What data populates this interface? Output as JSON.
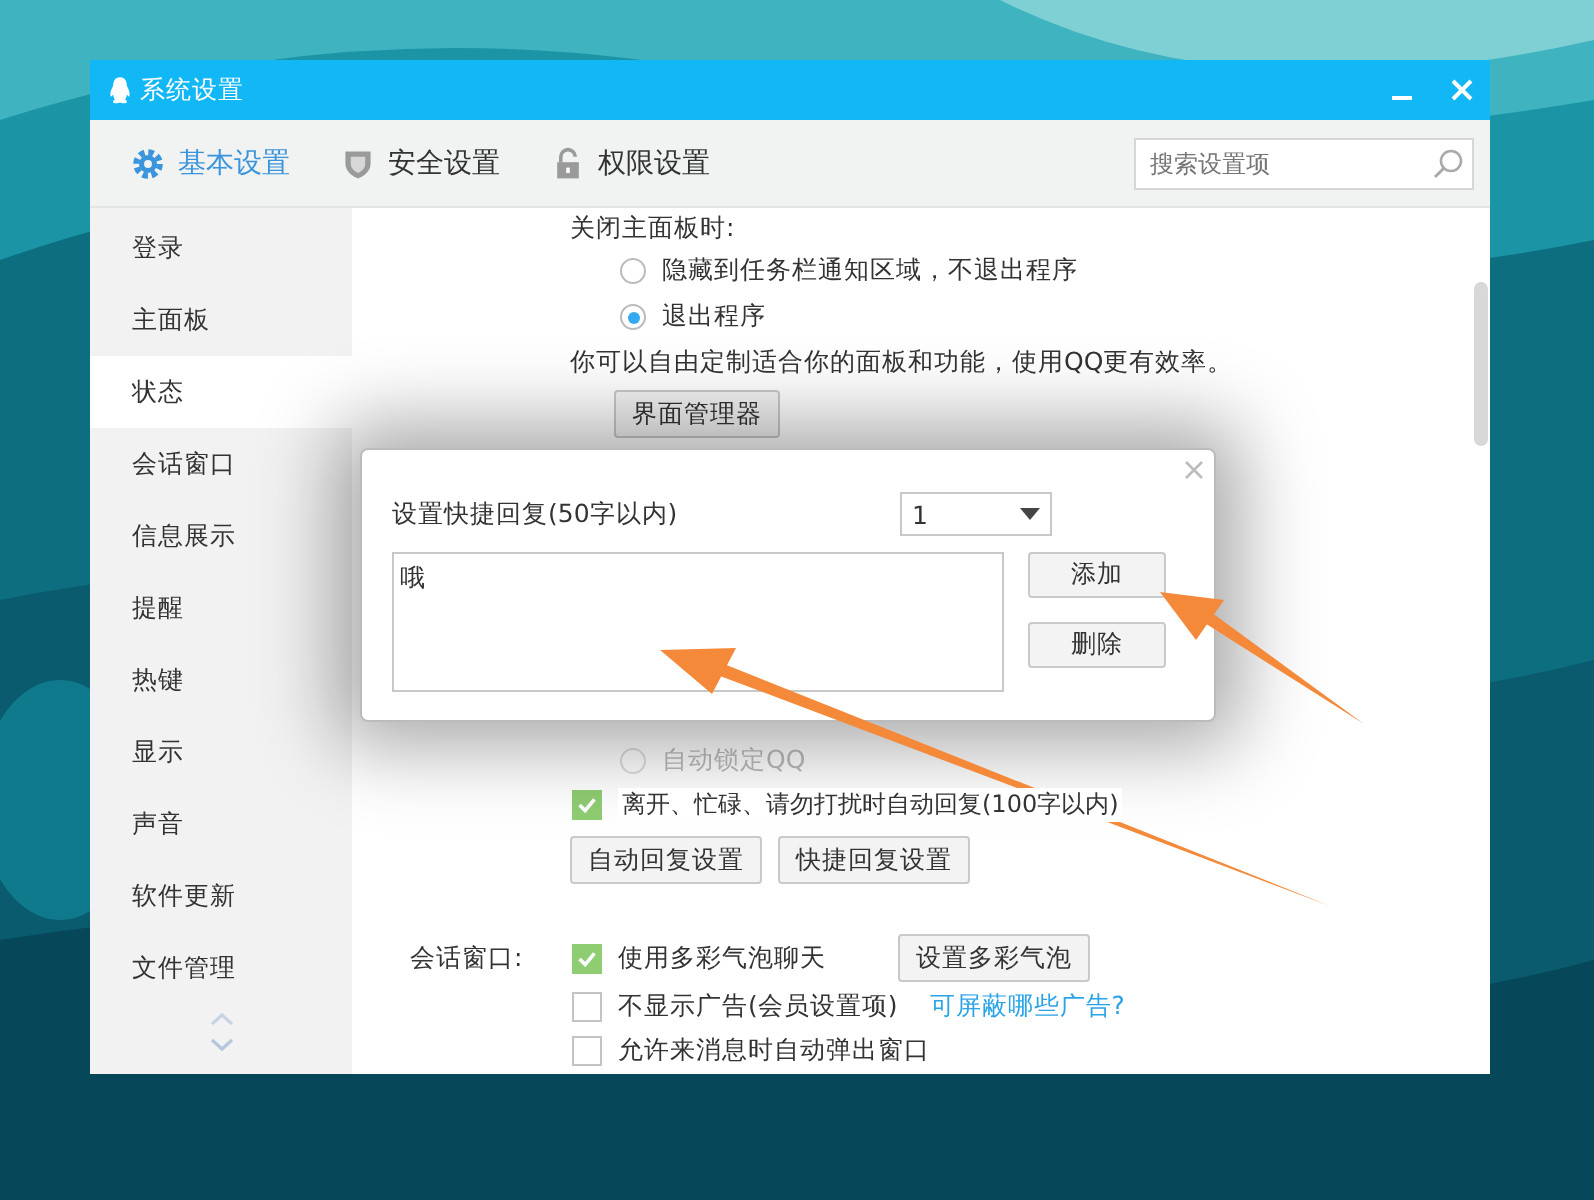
{
  "window": {
    "title": "系统设置"
  },
  "tabs": [
    {
      "label": "基本设置",
      "selected": true
    },
    {
      "label": "安全设置",
      "selected": false
    },
    {
      "label": "权限设置",
      "selected": false
    }
  ],
  "search": {
    "placeholder": "搜索设置项"
  },
  "sidebar": {
    "items": [
      {
        "label": "登录",
        "selected": false
      },
      {
        "label": "主面板",
        "selected": false
      },
      {
        "label": "状态",
        "selected": true
      },
      {
        "label": "会话窗口",
        "selected": false
      },
      {
        "label": "信息展示",
        "selected": false
      },
      {
        "label": "提醒",
        "selected": false
      },
      {
        "label": "热键",
        "selected": false
      },
      {
        "label": "显示",
        "selected": false
      },
      {
        "label": "声音",
        "selected": false
      },
      {
        "label": "软件更新",
        "selected": false
      },
      {
        "label": "文件管理",
        "selected": false
      }
    ]
  },
  "content": {
    "close_panel": {
      "label": "关闭主面板时:",
      "options": [
        {
          "label": "隐藏到任务栏通知区域，不退出程序",
          "selected": false
        },
        {
          "label": "退出程序",
          "selected": true
        }
      ]
    },
    "customize_text": "你可以自由定制适合你的面板和功能，使用QQ更有效率。",
    "customize_button": "界面管理器",
    "auto_lock": {
      "label": "自动锁定QQ",
      "selected": false
    },
    "auto_reply": {
      "label": "离开、忙碌、请勿打扰时自动回复(100字以内)",
      "checked": true
    },
    "reply_buttons": [
      "自动回复设置",
      "快捷回复设置"
    ],
    "chat_window": {
      "label": "会话窗口:",
      "bubbles": {
        "label": "使用多彩气泡聊天",
        "checked": true
      },
      "bubble_button": "设置多彩气泡",
      "no_ads": {
        "label": "不显示广告(会员设置项)",
        "checked": false
      },
      "ads_link": "可屏蔽哪些广告?",
      "auto_popup": {
        "label": "允许来消息时自动弹出窗口",
        "checked": false
      }
    }
  },
  "dialog": {
    "label": "设置快捷回复(50字以内)",
    "select_value": "1",
    "text": "哦",
    "buttons": [
      "添加",
      "删除"
    ]
  }
}
